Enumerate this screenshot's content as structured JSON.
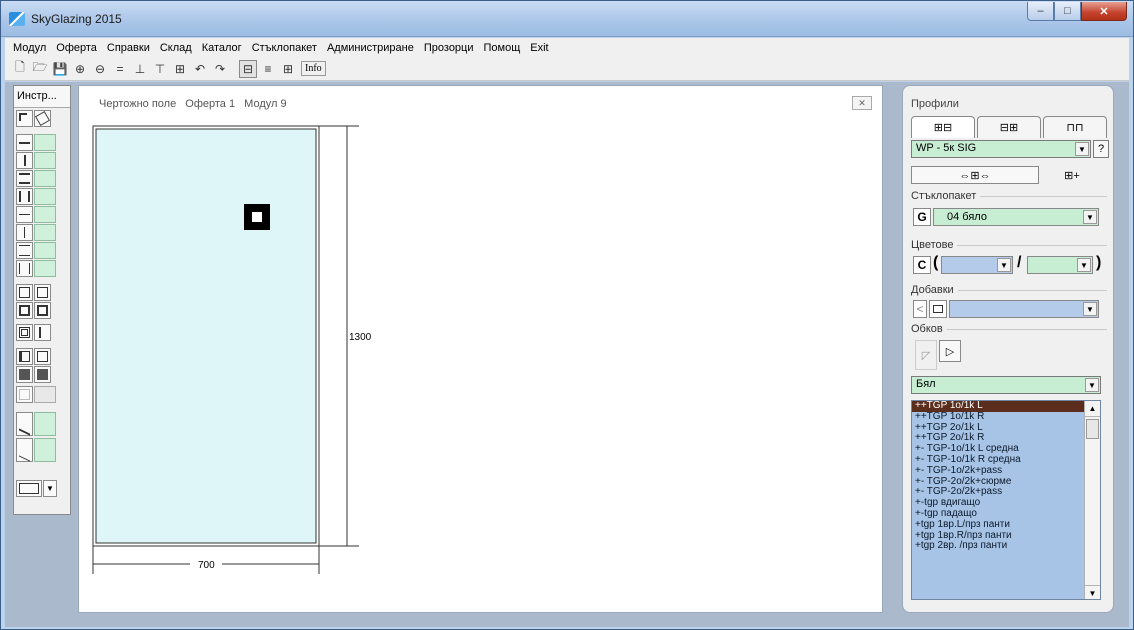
{
  "window": {
    "title": "SkyGlazing 2015",
    "buttons": [
      "–",
      "□",
      "✕"
    ]
  },
  "menu": [
    "Модул",
    "Оферта",
    "Справки",
    "Склад",
    "Каталог",
    "Стъклопакет",
    "Администриране",
    "Прозорци",
    "Помощ",
    "Exit"
  ],
  "toolbar": {
    "icons": [
      "new-file",
      "open-folder",
      "save",
      "zoom-in",
      "zoom-out",
      "equal",
      "profile-1",
      "profile-2",
      "grid-frame",
      "undo",
      "redo",
      "view-frame",
      "view-lines",
      "view-grid"
    ],
    "glyphs": [
      "🗋",
      "🗁",
      "💾",
      "⊕",
      "⊖",
      "=",
      "⊥",
      "⊤",
      "⊞",
      "↶",
      "↷",
      "⊟",
      "≡",
      "⊞"
    ],
    "info_label": "Info"
  },
  "palette": {
    "title": "Инстр..."
  },
  "drawing": {
    "title_parts": [
      "Чертожно поле",
      "Оферта 1",
      "Модул 9"
    ],
    "close": "✕",
    "width_label": "700",
    "height_label": "1300",
    "width_mm": 700,
    "height_mm": 1300,
    "glass_color": "#dff6f8"
  },
  "props": {
    "title": "Профили",
    "profile_combo": "WP - 5к SIG",
    "help": "?",
    "glass_section": "Стъклопакет",
    "glass_btn": "G",
    "glass_value": "04 бяло",
    "colors_section": "Цветове",
    "colors_btn": "C",
    "paren_open": "(",
    "slash": "/",
    "paren_close": ")",
    "additions_section": "Добавки",
    "additions_left": "<",
    "hardware_section": "Обков",
    "hardware_combo": "Бял",
    "fittings": [
      "++TGP 1o/1k L",
      "++TGP 1o/1k R",
      "++TGP 2o/1k L",
      "++TGP 2o/1k R",
      "+- TGP-1o/1k L средна",
      "+- TGP-1o/1k R средна",
      "+- TGP-1o/2k+pass",
      "+- TGP-2o/2k+сюрме",
      "+- TGP-2o/2k+pass",
      "+-tgp вдигащо",
      "+-tgp падащо",
      "+tgp 1вр.L/прз панти",
      "+tgp 1вр.R/прз панти",
      "+tgp 2вр.  /прз панти"
    ],
    "selected_index": 0,
    "colors": {
      "list_bg": "#a7c4e6",
      "selected": "#5a2d1c",
      "combo_bg": "#c7eed3"
    }
  }
}
